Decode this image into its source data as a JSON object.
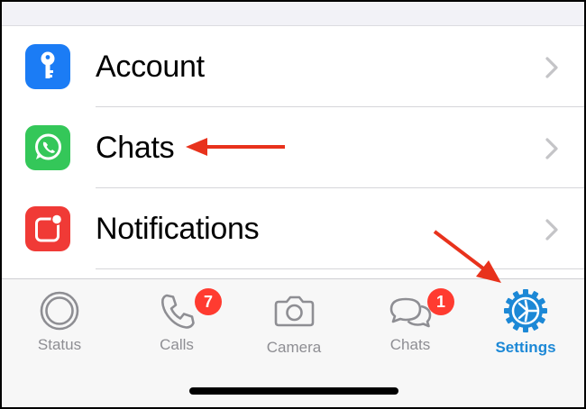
{
  "settings_list": {
    "items": [
      {
        "label": "Account",
        "icon": "key-icon",
        "color": "#1b7cf5"
      },
      {
        "label": "Chats",
        "icon": "whatsapp-icon",
        "color": "#34c759"
      },
      {
        "label": "Notifications",
        "icon": "notification-icon",
        "color": "#f03a36"
      }
    ]
  },
  "tab_bar": {
    "tabs": [
      {
        "label": "Status",
        "icon": "status-icon"
      },
      {
        "label": "Calls",
        "icon": "phone-icon",
        "badge": "7"
      },
      {
        "label": "Camera",
        "icon": "camera-icon"
      },
      {
        "label": "Chats",
        "icon": "chat-bubbles-icon",
        "badge": "1"
      },
      {
        "label": "Settings",
        "icon": "gear-icon",
        "active": true
      }
    ]
  },
  "colors": {
    "accent": "#1c88d6",
    "badge": "#ff3b30",
    "annotation_arrow": "#e8321c"
  }
}
